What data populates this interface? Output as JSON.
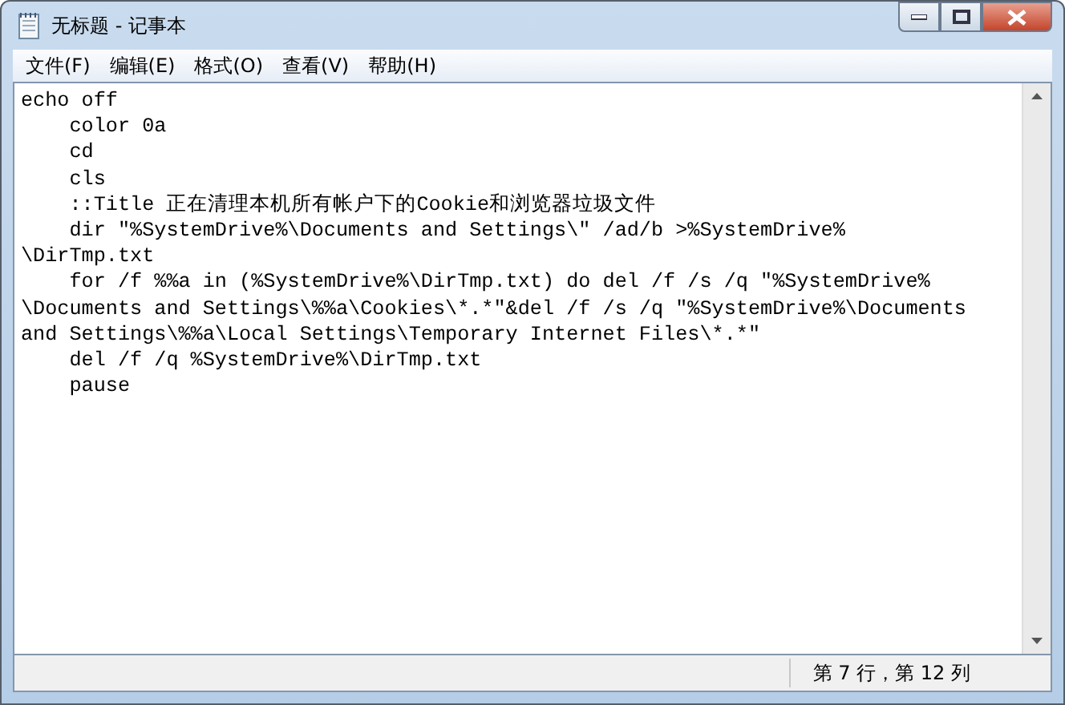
{
  "window": {
    "title": "无标题 - 记事本"
  },
  "menu": [
    "文件(F)",
    "编辑(E)",
    "格式(O)",
    "查看(V)",
    "帮助(H)"
  ],
  "editor": {
    "lines": [
      "echo off",
      "    color 0a",
      "    cd",
      "    cls",
      "    ::Title 正在清理本机所有帐户下的Cookie和浏览器垃圾文件",
      "    dir \"%SystemDrive%\\Documents and Settings\\\" /ad/b >%SystemDrive%",
      "\\DirTmp.txt",
      "    for /f %%a in (%SystemDrive%\\DirTmp.txt) do del /f /s /q \"%SystemDrive%",
      "\\Documents and Settings\\%%a\\Cookies\\*.*\"&del /f /s /q \"%SystemDrive%\\Documents",
      "and Settings\\%%a\\Local Settings\\Temporary Internet Files\\*.*\"",
      "    del /f /q %SystemDrive%\\DirTmp.txt",
      "    pause"
    ]
  },
  "status_bar": {
    "position": "第 7 行，第 12 列"
  }
}
